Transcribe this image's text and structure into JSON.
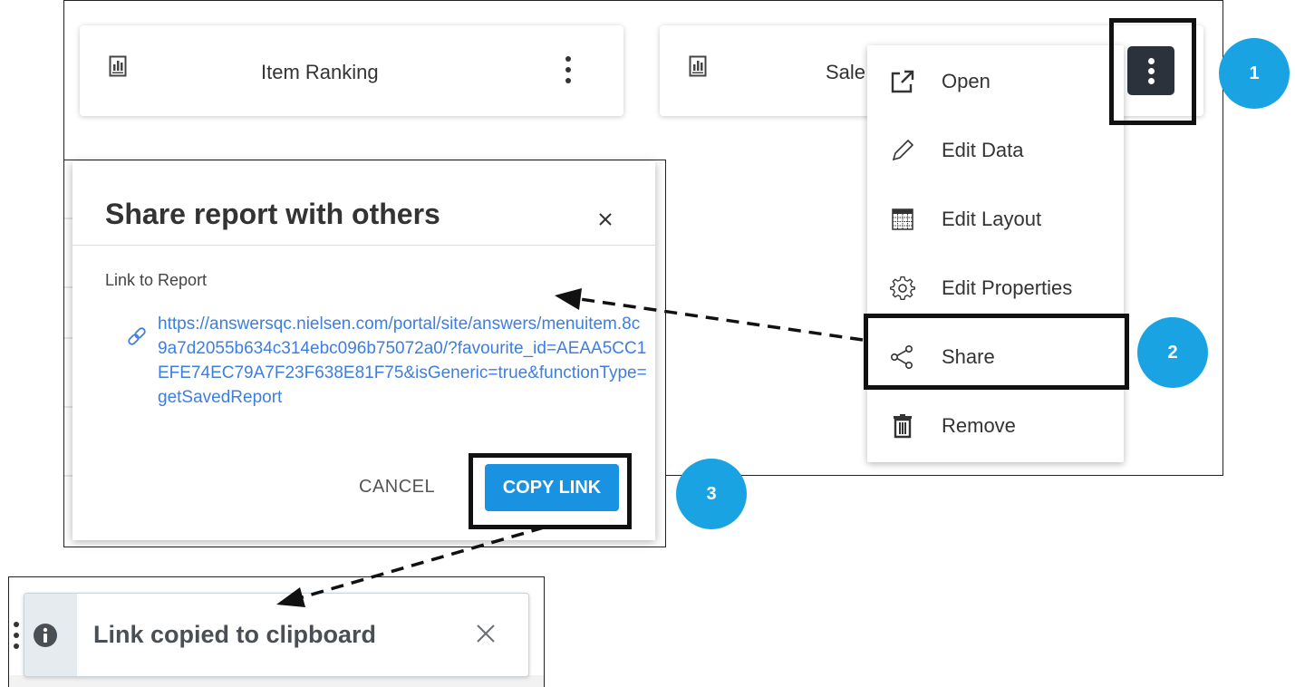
{
  "tiles": [
    {
      "label": "Item Ranking",
      "icon": "report-chart-icon"
    },
    {
      "label": "Sale",
      "icon": "report-chart-icon"
    }
  ],
  "menu": {
    "items": [
      {
        "label": "Open",
        "icon": "open-external-icon"
      },
      {
        "label": "Edit Data",
        "icon": "pencil-icon"
      },
      {
        "label": "Edit Layout",
        "icon": "layout-grid-icon"
      },
      {
        "label": "Edit Properties",
        "icon": "gear-icon"
      },
      {
        "label": "Share",
        "icon": "share-icon"
      },
      {
        "label": "Remove",
        "icon": "trash-icon"
      }
    ]
  },
  "badges": [
    "1",
    "2",
    "3"
  ],
  "dialog": {
    "title": "Share report with others",
    "link_label": "Link to Report",
    "link_url": "https://answersqc.nielsen.com/portal/site/answers/menuitem.8c9a7d2055b634c314ebc096b75072a0/?favourite_id=AEAA5CC1EFE74EC79A7F23F638E81F75&isGeneric=true&functionType=getSavedReport",
    "cancel_label": "CANCEL",
    "copy_label": "COPY LINK"
  },
  "toast": {
    "message": "Link copied to clipboard",
    "icon": "info-icon"
  },
  "colors": {
    "accent": "#1992e1",
    "badge": "#1aa3e3",
    "link": "#3d7ee0",
    "kebab_dark": "#2b323b"
  }
}
